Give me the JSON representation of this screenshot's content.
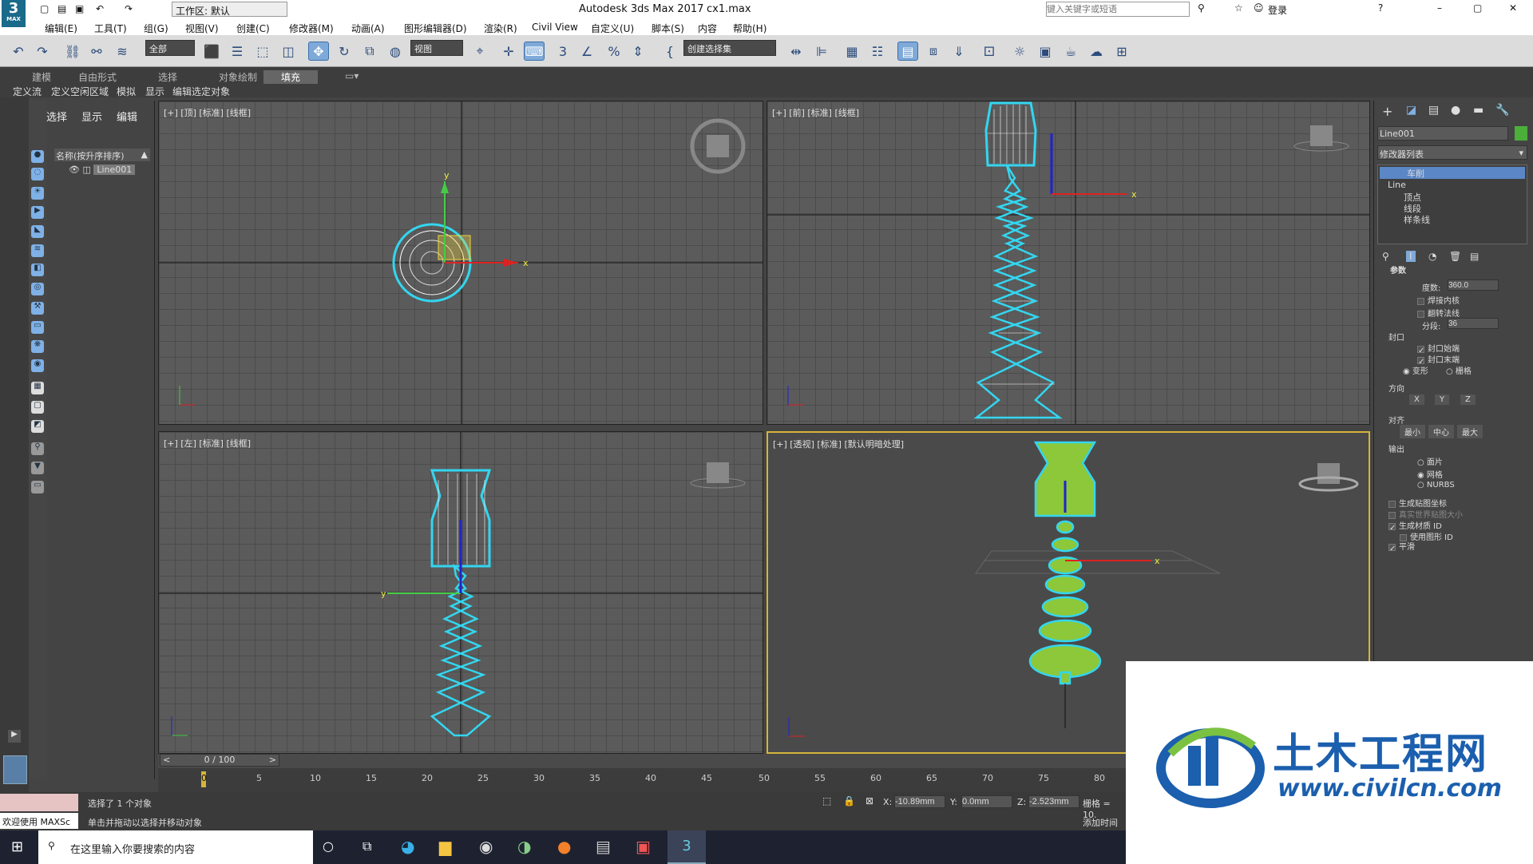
{
  "window": {
    "logo": "3",
    "logo_sub": "MAX",
    "workspace": "工作区: 默认",
    "title": "Autodesk 3ds Max 2017",
    "file": "cx1.max",
    "search_placeholder": "键入关键字或短语",
    "login": "登录",
    "minimize": "–",
    "maximize": "▢",
    "close": "✕"
  },
  "menu": [
    "编辑(E)",
    "工具(T)",
    "组(G)",
    "视图(V)",
    "创建(C)",
    "修改器(M)",
    "动画(A)",
    "图形编辑器(D)",
    "渲染(R)",
    "Civil View",
    "自定义(U)",
    "脚本(S)",
    "内容",
    "帮助(H)"
  ],
  "toolbar": {
    "filter": "全部",
    "coord": "视图",
    "named_sel": "创建选择集"
  },
  "ribbon": {
    "tabs": [
      "建模",
      "自由形式",
      "选择",
      "对象绘制",
      "填充"
    ],
    "subtabs": [
      "定义流",
      "定义空闲区域",
      "模拟",
      "显示",
      "编辑选定对象"
    ]
  },
  "scene": {
    "tabs": [
      "选择",
      "显示",
      "编辑"
    ],
    "col_header": "名称(按升序排序)",
    "item": "Line001"
  },
  "viewports": [
    {
      "label": "[+] [顶] [标准] [线框]"
    },
    {
      "label": "[+] [前] [标准] [线框]"
    },
    {
      "label": "[+] [左] [标准] [线框]"
    },
    {
      "label": "[+] [透视] [标准] [默认明暗处理]"
    }
  ],
  "command_panel": {
    "object_name": "Line001",
    "modifier_list": "修改器列表",
    "stack": [
      "车削",
      "Line",
      "顶点",
      "线段",
      "样条线"
    ],
    "rollout": "参数",
    "degrees_label": "度数:",
    "degrees": "360.0",
    "weld_core": "焊接内核",
    "flip_normals": "翻转法线",
    "segments_label": "分段:",
    "segments": "36",
    "capping": "封口",
    "cap_start": "封口始端",
    "cap_end": "封口末端",
    "morph": "变形",
    "grid": "栅格",
    "direction": "方向",
    "dir_x": "X",
    "dir_y": "Y",
    "dir_z": "Z",
    "align": "对齐",
    "min": "最小",
    "center": "中心",
    "max": "最大",
    "output": "输出",
    "patch": "面片",
    "mesh": "网格",
    "nurbs": "NURBS",
    "gen_map": "生成贴图坐标",
    "real_world": "真实世界贴图大小",
    "gen_mat": "生成材质 ID",
    "use_shape": "使用图形 ID",
    "smooth": "平滑"
  },
  "timeline": {
    "frame": "0 / 100",
    "ticks": [
      "0",
      "5",
      "10",
      "15",
      "20",
      "25",
      "30",
      "35",
      "40",
      "45",
      "50",
      "55",
      "60",
      "65",
      "70",
      "75",
      "80"
    ]
  },
  "status": {
    "welcome": "欢迎使用 MAXSc",
    "selected": "选择了 1 个对象",
    "hint": "单击并拖动以选择并移动对象",
    "x_label": "X:",
    "x": "-10.89mm",
    "y_label": "Y:",
    "y": "0.0mm",
    "z_label": "Z:",
    "z": "-2.523mm",
    "grid": "栅格 = 10.",
    "add_time": "添加时间"
  },
  "taskbar": {
    "search": "在这里输入你要搜索的内容"
  },
  "watermark": {
    "cn": "土木工程网",
    "url": "www.civilcn.com"
  }
}
